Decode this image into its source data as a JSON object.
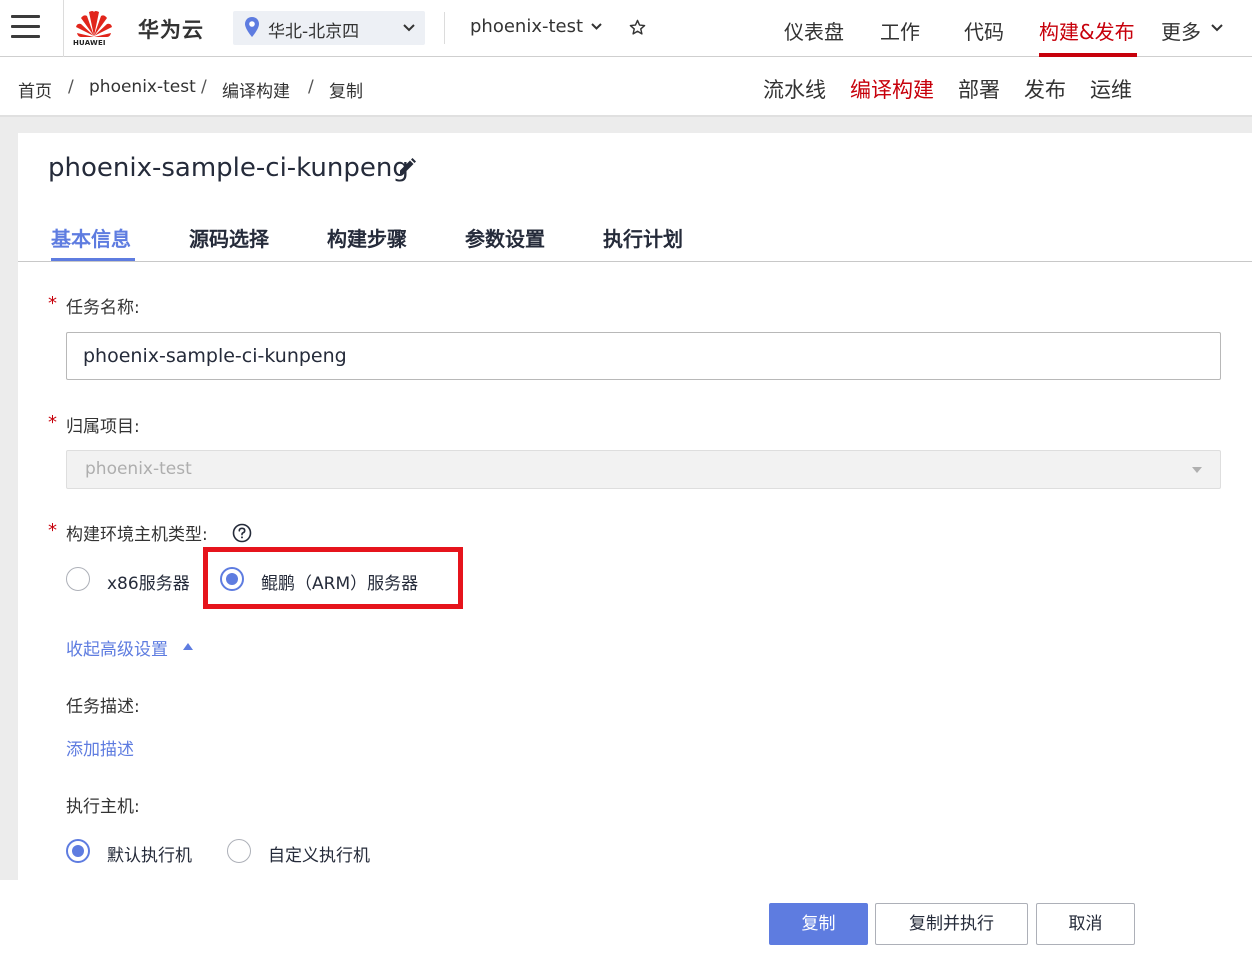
{
  "topbar": {
    "brand": "华为云",
    "logo_text": "HUAWEI",
    "region": "华北-北京四",
    "project": "phoenix-test",
    "nav": [
      "仪表盘",
      "工作",
      "代码",
      "构建&发布",
      "更多"
    ],
    "active_nav": "构建&发布",
    "accent_color": "#c7000b"
  },
  "breadcrumb": [
    "首页",
    "phoenix-test",
    "编译构建",
    "复制"
  ],
  "subnav": {
    "items": [
      "流水线",
      "编译构建",
      "部署",
      "发布",
      "运维"
    ],
    "active": "编译构建"
  },
  "page": {
    "title": "phoenix-sample-ci-kunpeng",
    "tabs": [
      "基本信息",
      "源码选择",
      "构建步骤",
      "参数设置",
      "执行计划"
    ],
    "active_tab": "基本信息"
  },
  "form": {
    "task_name_label": "任务名称:",
    "task_name_value": "phoenix-sample-ci-kunpeng",
    "project_label": "归属项目:",
    "project_value": "phoenix-test",
    "host_type_label": "构建环境主机类型:",
    "host_type_options": [
      "x86服务器",
      "鲲鹏（ARM）服务器"
    ],
    "host_type_selected": "鲲鹏（ARM）服务器",
    "advanced_toggle": "收起高级设置",
    "description_label": "任务描述:",
    "add_description": "添加描述",
    "executor_label": "执行主机:",
    "executor_options": [
      "默认执行机",
      "自定义执行机"
    ],
    "executor_selected": "默认执行机",
    "primary_color": "#5e7ce0"
  },
  "footer": {
    "copy": "复制",
    "copy_and_run": "复制并执行",
    "cancel": "取消"
  }
}
